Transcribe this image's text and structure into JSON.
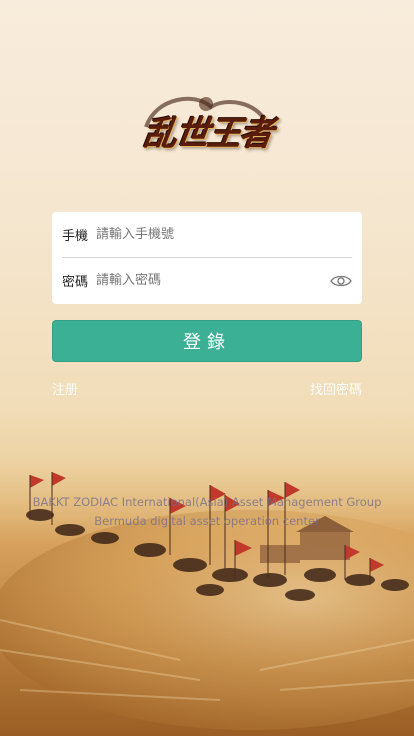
{
  "logo": {
    "text": "乱世王者"
  },
  "form": {
    "phone_label": "手機",
    "phone_placeholder": "請輸入手機號",
    "password_label": "密碼",
    "password_placeholder": "請輸入密碼"
  },
  "login_button": "登錄",
  "links": {
    "register": "注册",
    "forgot_password": "找回密碼"
  },
  "footer": {
    "line1": "BAKKT ZODIAC International(Asia) Asset Management Group",
    "line2": "Bermuda digital asset operation center"
  },
  "colors": {
    "accent": "#3bb095",
    "background_top": "#f8ecdc",
    "background_bottom": "#b97a36"
  }
}
